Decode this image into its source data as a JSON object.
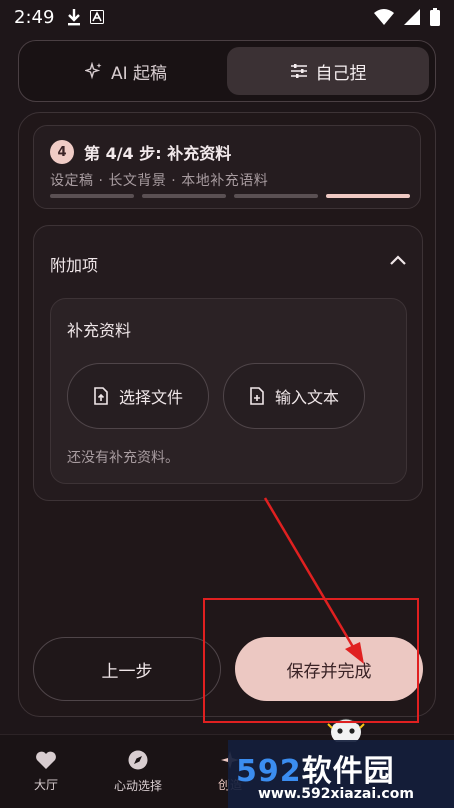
{
  "status": {
    "time": "2:49"
  },
  "segmented": {
    "ai_label": "AI 起稿",
    "manual_label": "自己捏",
    "active": "manual"
  },
  "step": {
    "number": "4",
    "title": "第 4/4 步: 补充资料",
    "subtitle": "设定稿 · 长文背景 · 本地补充语料",
    "total_steps": 4,
    "completed_steps": 4
  },
  "extras": {
    "title": "附加项",
    "expanded": true,
    "supplement": {
      "title": "补充资料",
      "choose_file_label": "选择文件",
      "input_text_label": "输入文本",
      "empty_text": "还没有补充资料。"
    }
  },
  "actions": {
    "prev_label": "上一步",
    "save_label": "保存并完成"
  },
  "nav": {
    "items": [
      {
        "label": "大厅",
        "icon": "heart-icon"
      },
      {
        "label": "心动选择",
        "icon": "compass-icon"
      },
      {
        "label": "创造",
        "icon": "sparkle-icon"
      }
    ]
  },
  "watermark": {
    "brand": "592",
    "brand_cn": "软件园",
    "url": "www.592xiazai.com"
  },
  "colors": {
    "accent": "#ecc8c2",
    "annotation": "#e02020"
  }
}
